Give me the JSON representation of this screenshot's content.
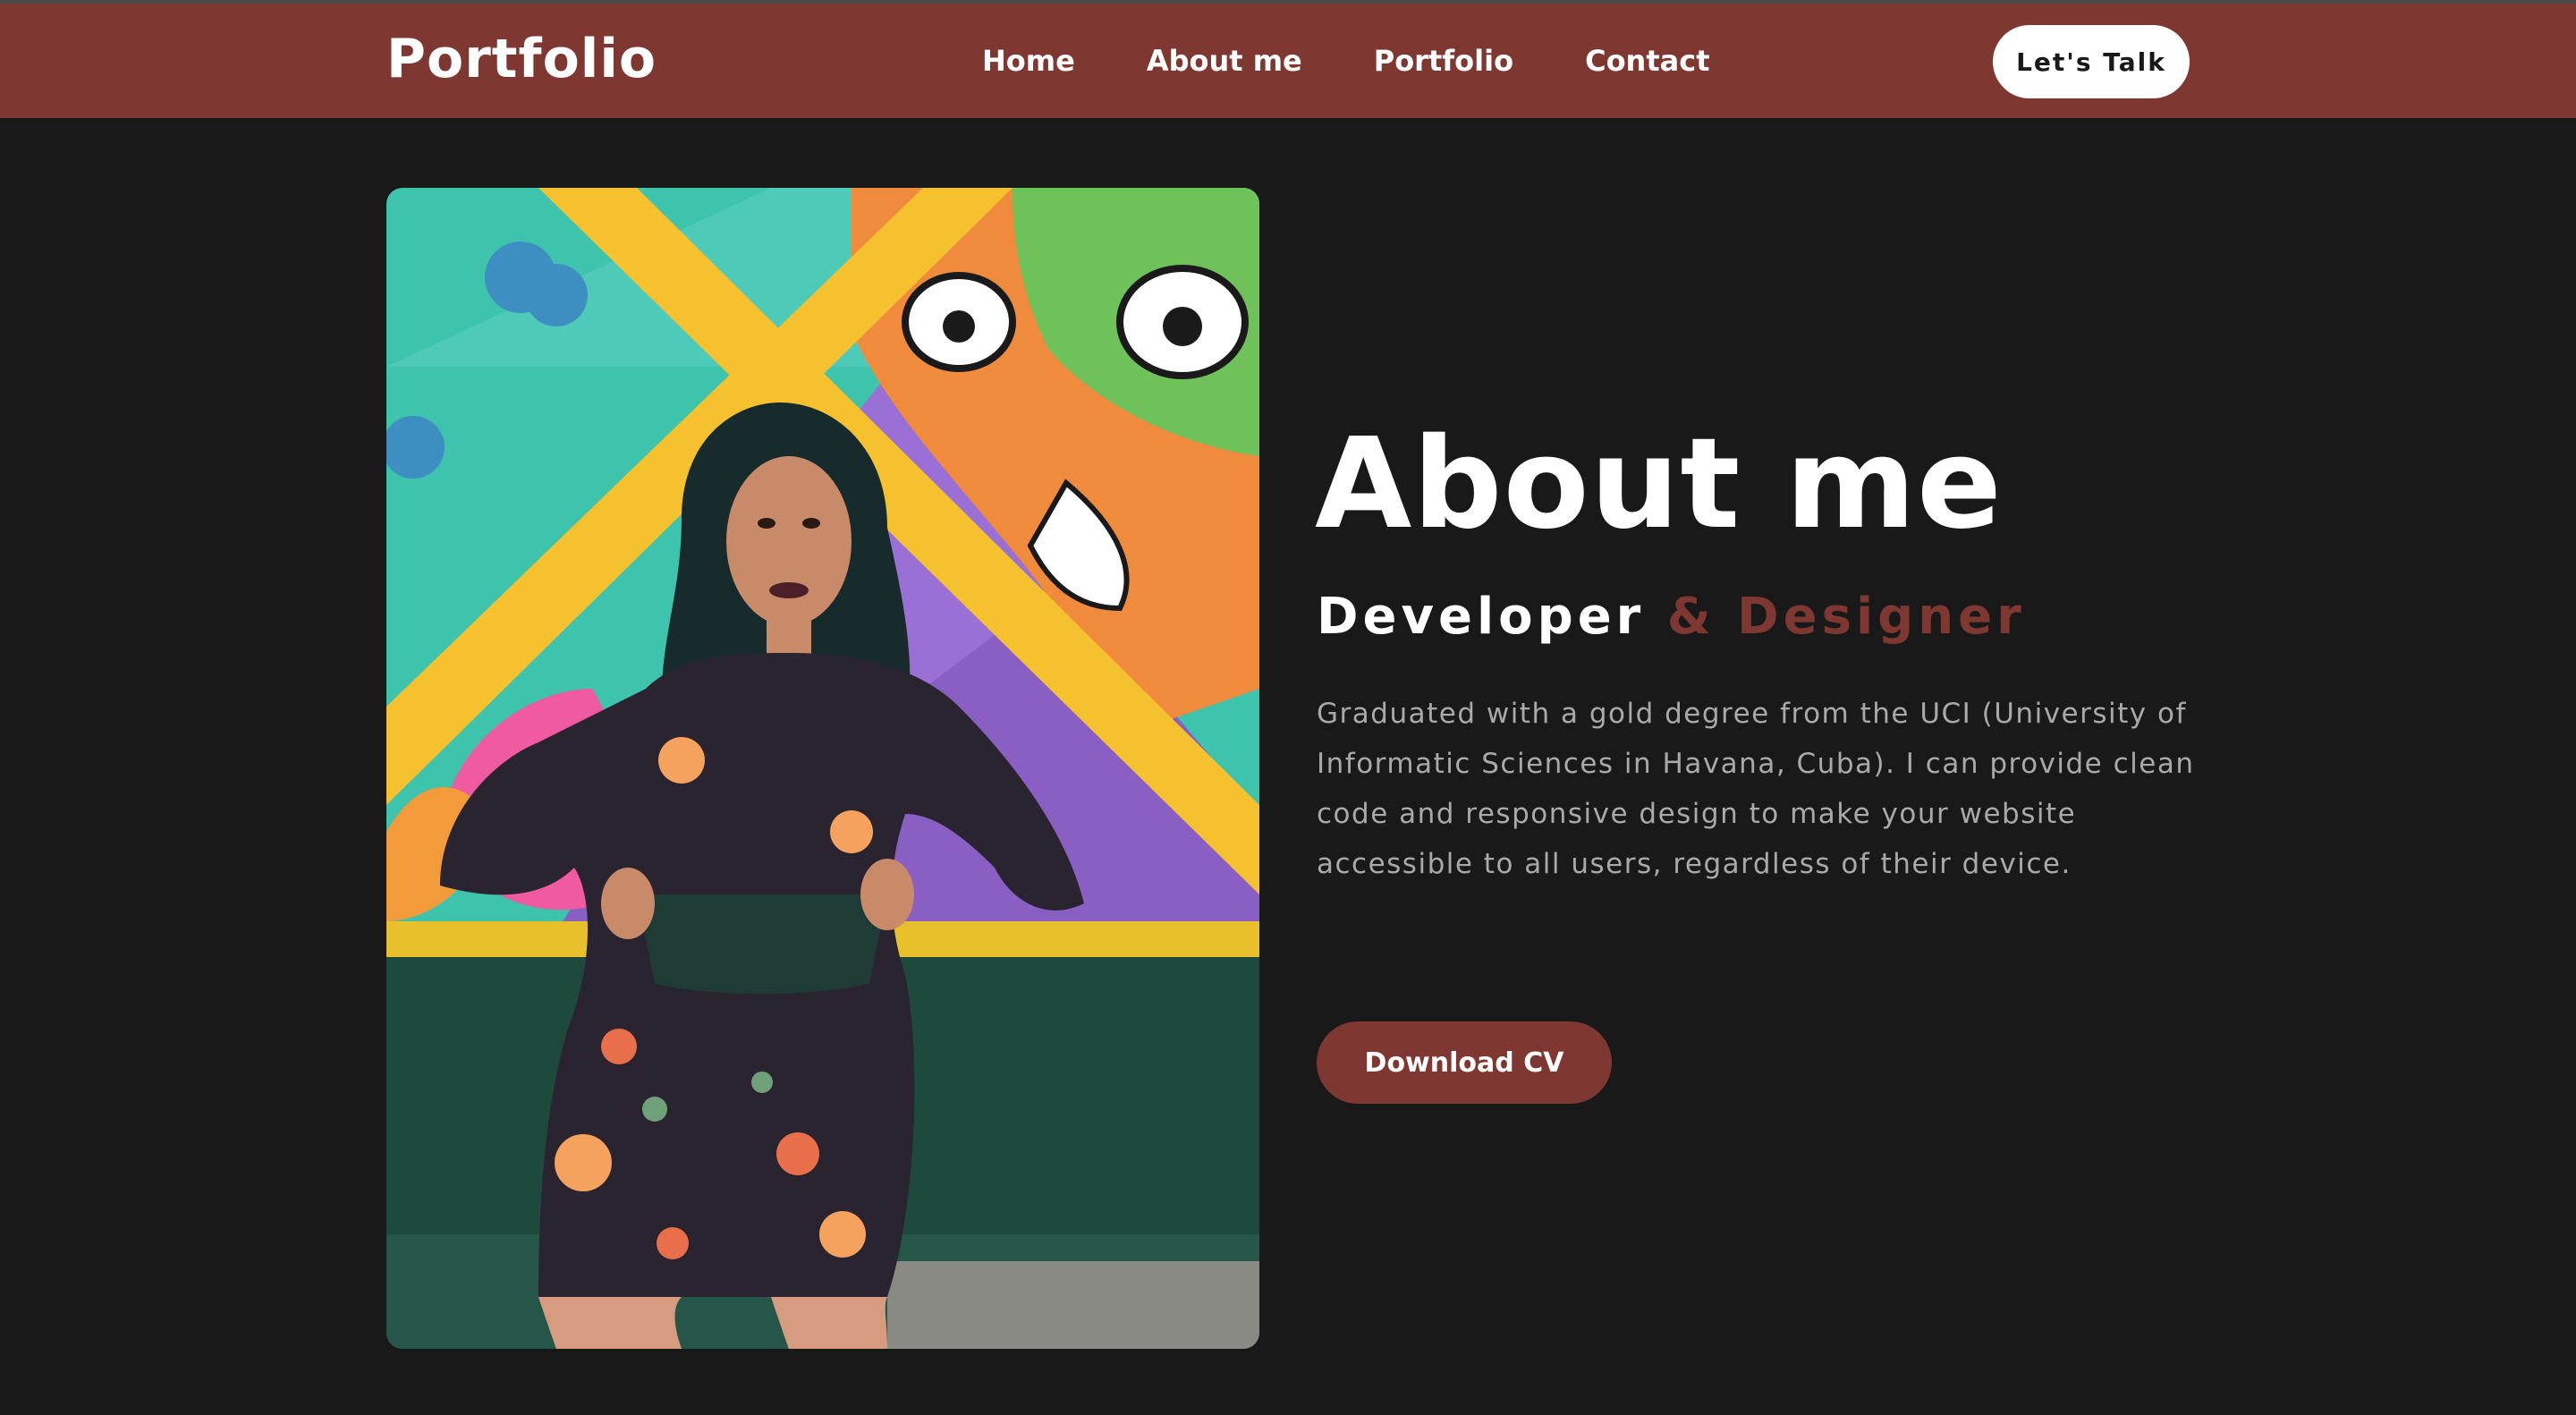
{
  "nav": {
    "brand": "Portfolio",
    "links": [
      "Home",
      "About me",
      "Portfolio",
      "Contact"
    ],
    "cta": "Let's Talk"
  },
  "about": {
    "title": "About me",
    "role_primary": "Developer",
    "role_secondary": "& Designer",
    "description": "Graduated with a gold degree from the UCI (University of Informatic Sciences in Havana, Cuba). I can provide clean code and responsive design to make your website accessible to all users, regardless of their device.",
    "download_label": "Download CV"
  },
  "colors": {
    "accent": "#7f3831",
    "background": "#191919",
    "text_muted": "#a9a9a9"
  }
}
